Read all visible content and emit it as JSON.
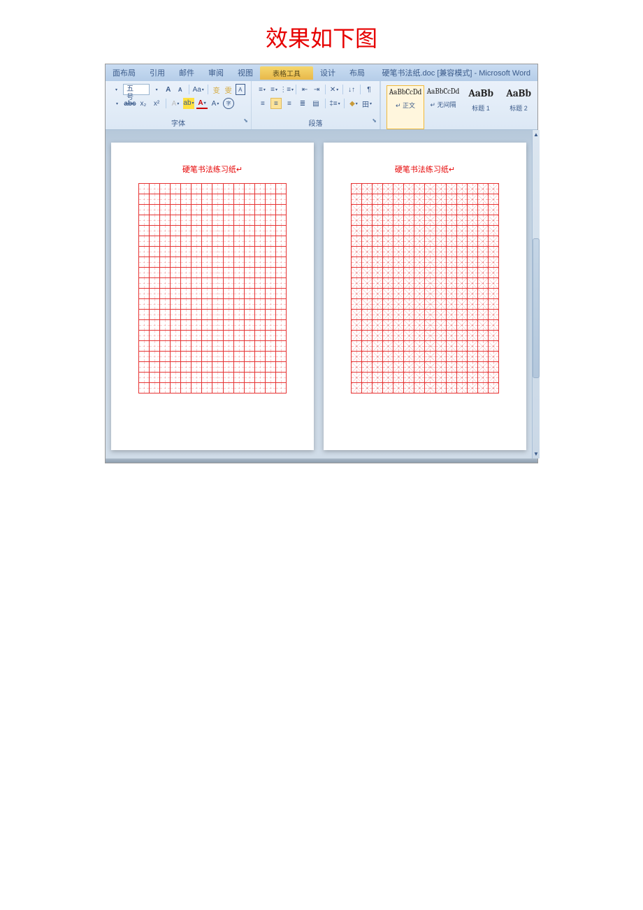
{
  "page_title": "效果如下图",
  "word": {
    "doc_title": "硬笔书法纸.doc [兼容模式] - Microsoft Word",
    "tabs": [
      "面布局",
      "引用",
      "邮件",
      "审阅",
      "视图"
    ],
    "table_tools": {
      "context": "表格工具",
      "subtabs": [
        "设计",
        "布局"
      ]
    },
    "font_group": {
      "label": "字体",
      "size": "五号",
      "btns_row1": [
        "A",
        "A",
        "Aa",
        "|",
        "variant-icon",
        "convert-icon",
        "A-box"
      ],
      "btns_row2": [
        "abc",
        "x₂",
        "x²",
        "|",
        "highlight-icon",
        "A-color",
        "A-underline-color",
        "A-effect",
        "char-border"
      ]
    },
    "para_group": {
      "label": "段落",
      "btns_row1": [
        "bullet-list",
        "number-list",
        "multilevel",
        "|",
        "outdent",
        "indent",
        "|",
        "show-marks",
        "|",
        "sort",
        "|",
        "toggle"
      ],
      "aligns": [
        "left",
        "center",
        "right",
        "justify",
        "distribute"
      ],
      "active_align": "center",
      "btns_row2_extra": [
        "line-spacing",
        "|",
        "shading",
        "|",
        "borders"
      ]
    },
    "styles": [
      {
        "preview": "AaBbCcDd",
        "name": "↵ 正文",
        "selected": true,
        "big": false
      },
      {
        "preview": "AaBbCcDd",
        "name": "↵ 无间隔",
        "selected": false,
        "big": false
      },
      {
        "preview": "AaBb",
        "name": "标题 1",
        "selected": false,
        "big": true
      },
      {
        "preview": "AaBb",
        "name": "标题 2",
        "selected": false,
        "big": true
      }
    ]
  },
  "pages": {
    "left": {
      "title": "硬笔书法练习纸↵",
      "type": "plain",
      "rows": 20,
      "cols": 14
    },
    "right": {
      "title": "硬笔书法练习纸↵",
      "type": "mizi",
      "rows": 20,
      "cols": 14
    }
  }
}
